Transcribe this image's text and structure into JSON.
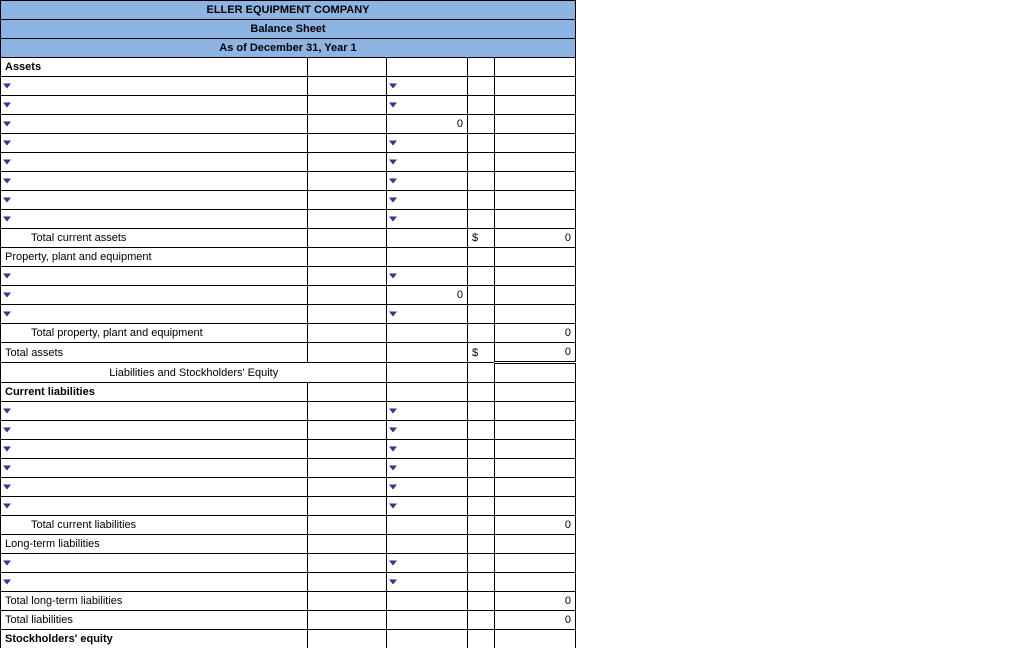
{
  "header": {
    "company": "ELLER EQUIPMENT COMPANY",
    "title": "Balance Sheet",
    "date": "As of December 31, Year 1"
  },
  "sections": {
    "assets_label": "Assets",
    "total_current_assets": "Total current assets",
    "ppe": "Property, plant and equipment",
    "total_ppe": "Total property, plant and equipment",
    "total_assets": "Total assets",
    "liab_equity_header": "Liabilities and Stockholders' Equity",
    "current_liab": "Current liabilities",
    "total_current_liab": "Total current liabilities",
    "long_term_liab": "Long-term liabilities",
    "total_long_term_liab": "Total long-term liabilities",
    "total_liab": "Total liabilities",
    "stockholders_equity": "Stockholders' equity"
  },
  "values": {
    "zero": "0",
    "dollar": "$"
  }
}
